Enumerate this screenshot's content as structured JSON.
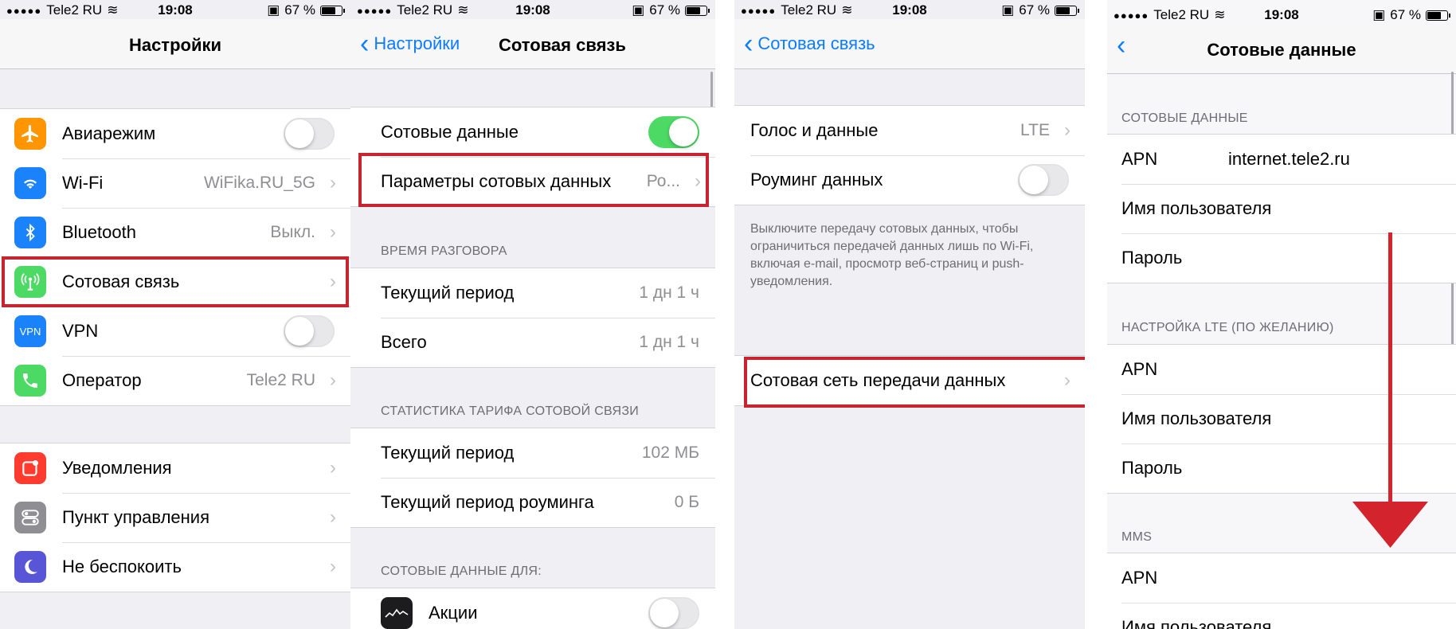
{
  "status": {
    "carrier": "Tele2 RU",
    "time": "19:08",
    "battery": "67 %"
  },
  "screen1": {
    "title": "Настройки",
    "group1": [
      {
        "label": "Авиарежим",
        "icon": "airplane-icon",
        "color": "#ff9500",
        "toggle": false
      },
      {
        "label": "Wi-Fi",
        "value": "WiFika.RU_5G",
        "icon": "wifi-icon",
        "color": "#1a82fb"
      },
      {
        "label": "Bluetooth",
        "value": "Выкл.",
        "icon": "bluetooth-icon",
        "color": "#1a82fb"
      },
      {
        "label": "Сотовая связь",
        "icon": "cellular-antenna-icon",
        "color": "#4cd964"
      },
      {
        "label": "VPN",
        "icon": "vpn-icon",
        "icon_text": "VPN",
        "color": "#1a82fb",
        "toggle": false
      },
      {
        "label": "Оператор",
        "value": "Tele2 RU",
        "icon": "phone-icon",
        "color": "#4cd964"
      }
    ],
    "group2": [
      {
        "label": "Уведомления",
        "icon": "notifications-icon",
        "color": "#ff3b30"
      },
      {
        "label": "Пункт управления",
        "icon": "control-center-icon",
        "color": "#8e8e93"
      },
      {
        "label": "Не беспокоить",
        "icon": "moon-icon",
        "color": "#5856d6"
      }
    ]
  },
  "screen2": {
    "back": "Настройки",
    "title": "Сотовая связь",
    "cellular_data": "Сотовые данные",
    "cellular_params": "Параметры сотовых данных",
    "cellular_params_value": "Ро...",
    "call_time_header": "ВРЕМЯ РАЗГОВОРА",
    "call_rows": [
      {
        "label": "Текущий период",
        "value": "1 дн 1 ч"
      },
      {
        "label": "Всего",
        "value": "1 дн 1 ч"
      }
    ],
    "stats_header": "СТАТИСТИКА ТАРИФА СОТОВОЙ СВЯЗИ",
    "stats_rows": [
      {
        "label": "Текущий период",
        "value": "102 МБ"
      },
      {
        "label": "Текущий период роуминга",
        "value": "0 Б"
      }
    ],
    "data_for_header": "СОТОВЫЕ ДАННЫЕ ДЛЯ:",
    "app": "Акции"
  },
  "screen3": {
    "back": "Сотовая связь",
    "voice_data": "Голос и данные",
    "voice_data_value": "LTE",
    "roaming": "Роуминг данных",
    "footnote": "Выключите передачу сотовых данных, чтобы ограничиться передачей данных лишь по Wi-Fi, включая e-mail, просмотр веб-страниц и push-уведомления.",
    "network": "Сотовая сеть передачи данных"
  },
  "screen4": {
    "title": "Сотовые данные",
    "sec1_header": "СОТОВЫЕ ДАННЫЕ",
    "sec1": [
      {
        "label": "APN",
        "value": "internet.tele2.ru"
      },
      {
        "label": "Имя пользователя",
        "value": ""
      },
      {
        "label": "Пароль",
        "value": ""
      }
    ],
    "sec2_header": "НАСТРОЙКА LTE (ПО ЖЕЛАНИЮ)",
    "sec2": [
      {
        "label": "APN"
      },
      {
        "label": "Имя пользователя"
      },
      {
        "label": "Пароль"
      }
    ],
    "sec3_header": "MMS",
    "sec3": [
      {
        "label": "APN"
      },
      {
        "label": "Имя пользователя"
      }
    ]
  },
  "colors": {
    "accent": "#0b7bff",
    "highlight": "#c8242f",
    "toggle_on": "#4cd964",
    "arrow": "#d3232c"
  }
}
